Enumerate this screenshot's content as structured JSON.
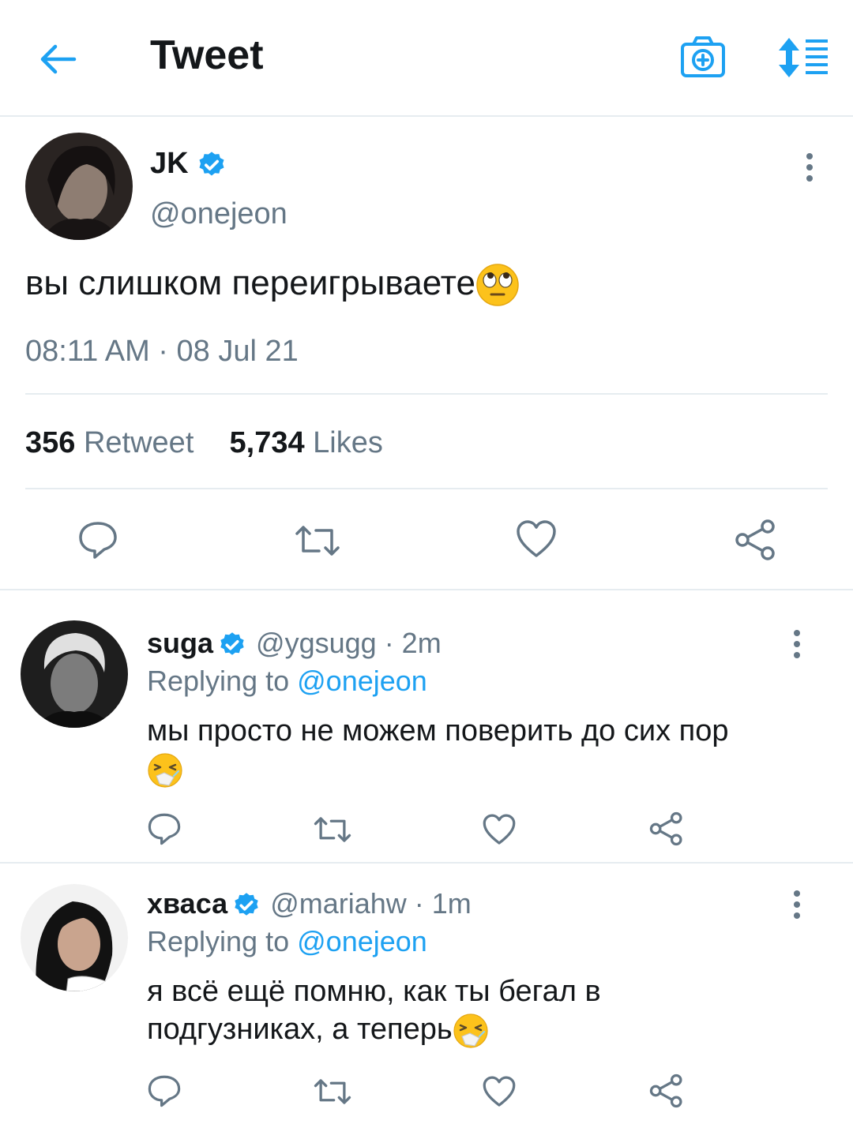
{
  "header": {
    "title": "Tweet"
  },
  "tweet": {
    "name": "JK",
    "handle": "@onejeon",
    "text": "вы слишком переигрываете",
    "emoji": "face-with-rolling-eyes",
    "timestamp": "08:11 AM · 08 Jul 21",
    "retweet_count": "356",
    "retweet_label": "Retweet",
    "likes_count": "5,734",
    "likes_label": "Likes"
  },
  "replies": [
    {
      "name": "suga",
      "handle": "@ygsugg",
      "time": "· 2m",
      "replying_prefix": "Replying to",
      "replying_to": "@onejeon",
      "text": "мы просто не можем поверить до сих пор",
      "emoji": "sneezing-face"
    },
    {
      "name": "хваса",
      "handle": "@mariahw",
      "time": "· 1m",
      "replying_prefix": "Replying to",
      "replying_to": "@onejeon",
      "text": "я всё ещё помню, как ты бегал в подгузниках, а теперь",
      "emoji": "sneezing-face"
    }
  ],
  "icons": {
    "back": "arrow-left-icon",
    "camera": "camera-plus-icon",
    "sort": "sort-list-icon",
    "verified": "verified-badge-icon",
    "more": "vertical-dots-icon",
    "reply": "speech-bubble-icon",
    "retweet": "retweet-icon",
    "like": "heart-icon",
    "share": "share-icon"
  },
  "colors": {
    "accent": "#1da1f2",
    "text": "#14171a",
    "secondary": "#657786",
    "divider": "#e6ecf0"
  }
}
